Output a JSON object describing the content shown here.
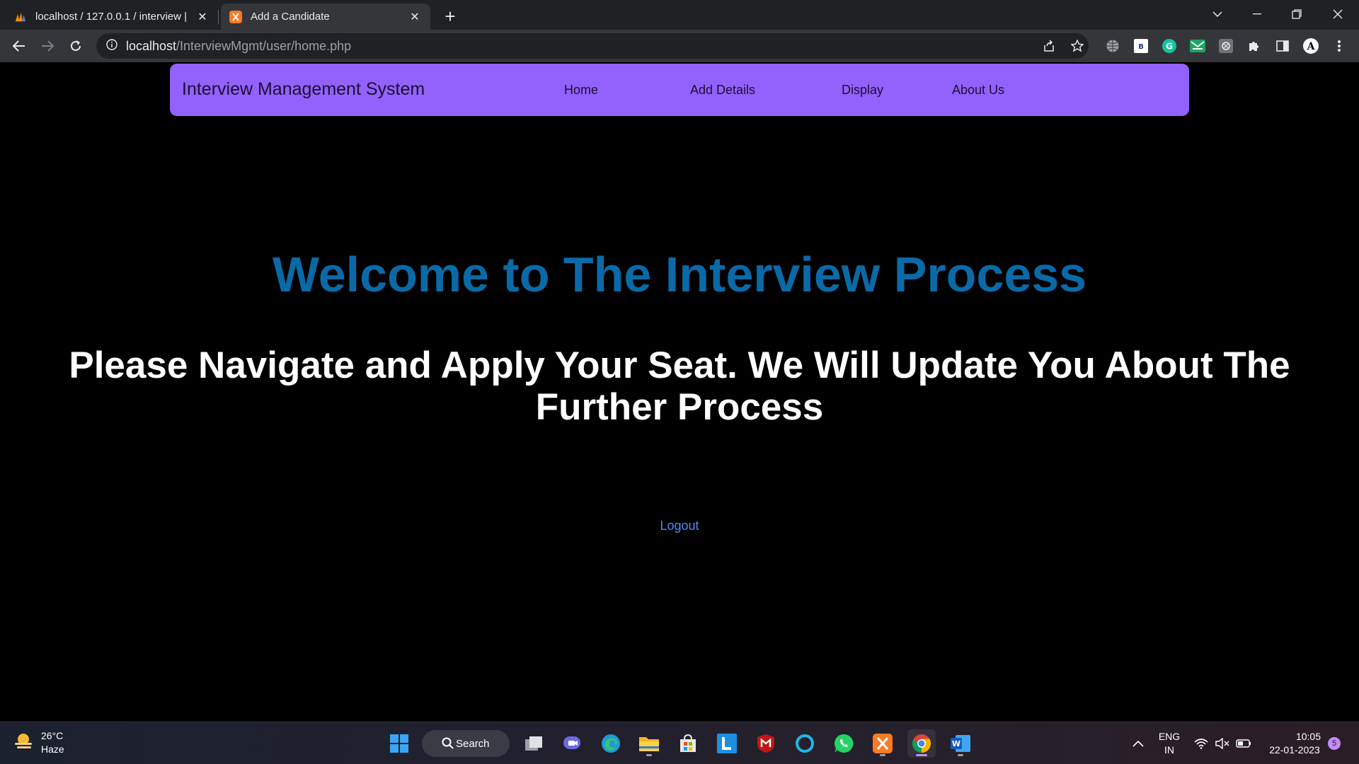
{
  "browser": {
    "tabs": [
      {
        "title": "localhost / 127.0.0.1 / interview |",
        "favicon": "phpmyadmin-icon"
      },
      {
        "title": "Add a Candidate",
        "favicon": "xampp-icon"
      }
    ],
    "url_host": "localhost",
    "url_path": "/InterviewMgmt/user/home.php"
  },
  "navbar": {
    "brand": "Interview Management System",
    "links": [
      "Home",
      "Add Details",
      "Display",
      "About Us"
    ],
    "color": "#9361fb"
  },
  "main": {
    "welcome": "Welcome to The Interview Process",
    "subtext": "Please Navigate and Apply Your Seat. We Will Update You About The Further Process",
    "logout": "Logout"
  },
  "taskbar": {
    "weather_temp": "26°C",
    "weather_desc": "Haze",
    "search_label": "Search",
    "lang_top": "ENG",
    "lang_bottom": "IN",
    "time": "10:05",
    "date": "22-01-2023",
    "notification_count": "5"
  }
}
